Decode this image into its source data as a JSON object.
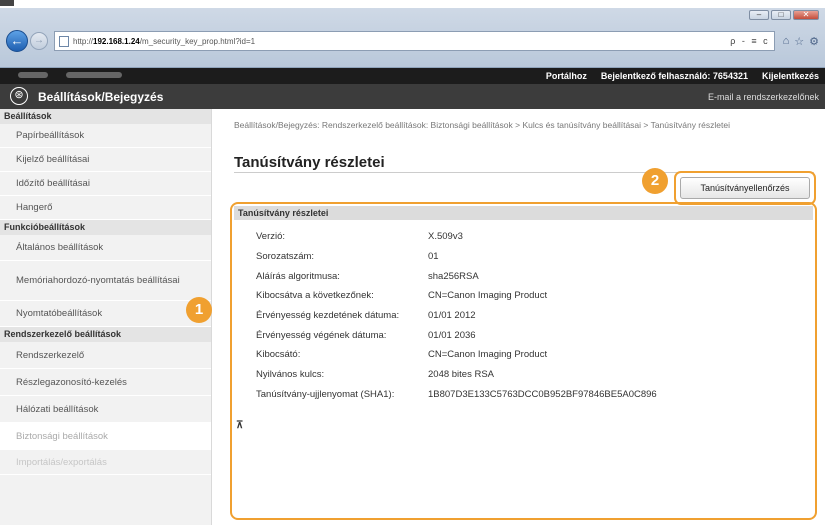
{
  "browser": {
    "window_buttons": [
      "–",
      "□",
      "✕"
    ],
    "url_host": "192.168.1.24",
    "url_prefix": "http://",
    "url_path": "/m_security_key_prop.html?id=1",
    "address_tools": "ρ - ≡ c",
    "toolbar_icons": [
      "home-icon",
      "star-icon",
      "gear-icon"
    ]
  },
  "status_bar": {
    "portal_link": "Portálhoz",
    "login_label": "Bejelentkező felhasználó:",
    "login_user": "7654321",
    "logout_link": "Kijelentkezés"
  },
  "app": {
    "title": "Beállítások/Bejegyzés",
    "mail_link": "E-mail a rendszerkezelőnek",
    "logo_glyph": "⊛"
  },
  "sidebar": {
    "sections": [
      {
        "title": "Beállítások",
        "items": [
          {
            "label": "Papírbeállítások"
          },
          {
            "label": "Kijelző beállításai"
          },
          {
            "label": "Időzítő beállításai"
          },
          {
            "label": "Hangerő"
          }
        ]
      },
      {
        "title": "Funkcióbeállítások",
        "items": [
          {
            "label": "Általános beállítások"
          },
          {
            "label": "Memóriahordozó-nyomtatás beállításai"
          },
          {
            "label": "Nyomtatóbeállítások"
          }
        ]
      },
      {
        "title": "Rendszerkezelő beállítások",
        "items": [
          {
            "label": "Rendszerkezelő"
          },
          {
            "label": "Részlegazonosító-kezelés"
          },
          {
            "label": "Hálózati beállítások"
          },
          {
            "label": "Biztonsági beállítások"
          },
          {
            "label": "Importálás/exportálás"
          }
        ]
      }
    ]
  },
  "main": {
    "breadcrumb": "Beállítások/Bejegyzés: Rendszerkezelő beállítások: Biztonsági beállítások > Kulcs és tanúsítvány beállításai > Tanúsítvány részletei",
    "page_title": "Tanúsítvány részletei",
    "check_button": "Tanúsítványellenőrzés",
    "details_header": "Tanúsítvány részletei",
    "details": [
      {
        "key": "Verzió:",
        "value": "X.509v3"
      },
      {
        "key": "Sorozatszám:",
        "value": "01"
      },
      {
        "key": "Aláírás algoritmusa:",
        "value": "sha256RSA"
      },
      {
        "key": "Kibocsátva a következőnek:",
        "value": "CN=Canon Imaging Product"
      },
      {
        "key": "Érvényesség kezdetének dátuma:",
        "value": "01/01 2012"
      },
      {
        "key": "Érvényesség végének dátuma:",
        "value": "01/01 2036"
      },
      {
        "key": "Kibocsátó:",
        "value": "CN=Canon Imaging Product"
      },
      {
        "key": "Nyilvános kulcs:",
        "value": "2048 bites RSA"
      },
      {
        "key": "Tanúsítvány-ujjlenyomat (SHA1):",
        "value": "1B807D3E133C5763DCC0B952BF97846BE5A0C896"
      }
    ],
    "to_top": "⊼",
    "callout_1": "1",
    "callout_2": "2"
  },
  "colors": {
    "callout": "#f0a030",
    "app_header": "#3c3c3c",
    "status_bar": "#1c1c1c"
  }
}
